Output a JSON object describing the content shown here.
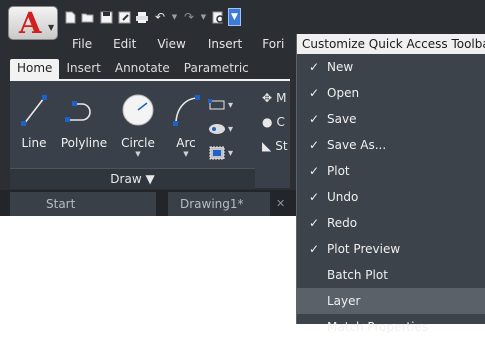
{
  "app": {
    "logo_letter": "A",
    "quick_access_icons": [
      "new-icon",
      "open-icon",
      "save-icon",
      "saveas-icon",
      "plot-icon",
      "undo-icon",
      "redo-icon",
      "plotpreview-icon",
      "customize-icon"
    ]
  },
  "menubar": [
    "File",
    "Edit",
    "View",
    "Insert",
    "Fori"
  ],
  "ribbon_tabs": [
    "Home",
    "Insert",
    "Annotate",
    "Parametric"
  ],
  "draw_tools": [
    "Line",
    "Polyline",
    "Circle",
    "Arc"
  ],
  "draw_panel_label": "Draw ▼",
  "right_tools": [
    "M",
    "C",
    "St"
  ],
  "doc_tabs": {
    "start": "Start",
    "drawing": "Drawing1*",
    "close": "✕"
  },
  "menu": {
    "title": "Customize Quick Access Toolbar",
    "items": [
      {
        "label": "New",
        "checked": true
      },
      {
        "label": "Open",
        "checked": true
      },
      {
        "label": "Save",
        "checked": true
      },
      {
        "label": "Save As...",
        "checked": true
      },
      {
        "label": "Plot",
        "checked": true
      },
      {
        "label": "Undo",
        "checked": true
      },
      {
        "label": "Redo",
        "checked": true
      },
      {
        "label": "Plot Preview",
        "checked": true
      },
      {
        "label": "Batch Plot",
        "checked": false
      },
      {
        "label": "Layer",
        "checked": false,
        "hover": true
      },
      {
        "label": "Match Properties",
        "checked": false
      }
    ]
  }
}
